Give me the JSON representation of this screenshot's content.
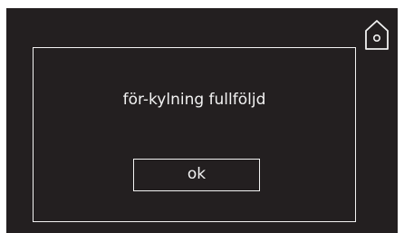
{
  "dialog": {
    "message": "för-kylning fullföljd",
    "ok_label": "ok"
  },
  "icons": {
    "home": "home-icon"
  },
  "colors": {
    "background": "#231f20",
    "foreground": "#f2f2f2"
  }
}
